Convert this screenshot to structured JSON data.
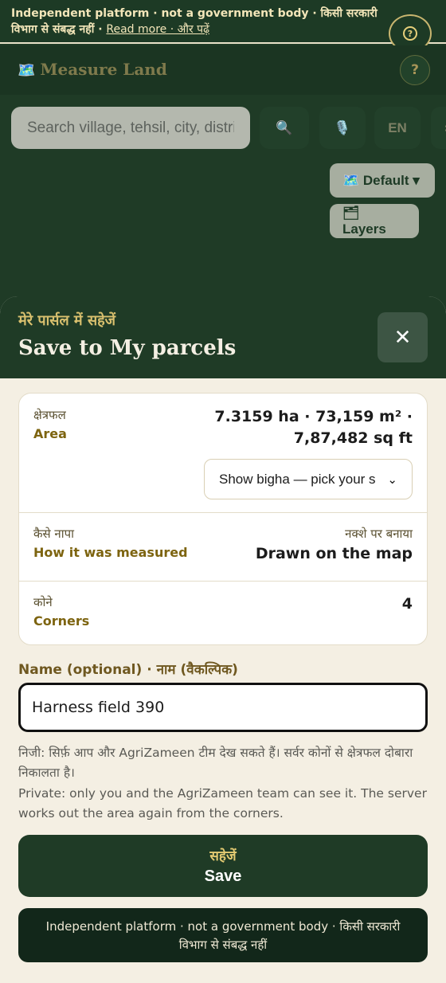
{
  "notice": {
    "text": "Independent platform · not a government body · किसी सरकारी विभाग से संबद्ध नहीं · ",
    "read_more": "Read more · और पढ़ें",
    "help_icon": "?"
  },
  "header": {
    "brand_icon": "🗺️",
    "brand": "Measure Land",
    "help_label": "?"
  },
  "search": {
    "placeholder": "Search village, tehsil, city, district"
  },
  "toolbar": {
    "search_icon": "🔍",
    "mic_icon": "🎙️",
    "lang": "EN",
    "more": "›"
  },
  "map_controls": {
    "basemap": "🗺️ Default ▾",
    "layers": "🗂 Layers"
  },
  "sheet": {
    "title_hi": "मेरे पार्सल में सहेजें",
    "title_en": "Save to My parcels",
    "close_icon": "✕"
  },
  "details": {
    "area": {
      "label_hi": "क्षेत्रफल",
      "label_en": "Area",
      "value_line1": "7.3159 ha · 73,159 m² ·",
      "value_line2": "7,87,482 sq ft",
      "bigha_select": "Show bigha — pick your s",
      "bigha_chevron": "⌄"
    },
    "method": {
      "label_hi": "कैसे नापा",
      "label_en": "How it was measured",
      "value_hi": "नक्शे पर बनाया",
      "value_en": "Drawn on the map"
    },
    "corners": {
      "label_hi": "कोने",
      "label_en": "Corners",
      "value": "4"
    }
  },
  "name_field": {
    "label": "Name (optional) · नाम (वैकल्पिक)",
    "value": "Harness field 390"
  },
  "privacy": {
    "hi": "निजी: सिर्फ़ आप और AgriZameen टीम देख सकते हैं। सर्वर कोनों से क्षेत्रफल दोबारा निकालता है।",
    "en": "Private: only you and the AgriZameen team can see it. The server works out the area again from the corners."
  },
  "save_button": {
    "hi": "सहेजें",
    "en": "Save"
  },
  "footer": {
    "text": "Independent platform · not a government body · किसी सरकारी विभाग से संबद्ध नहीं"
  },
  "colors": {
    "brand_green": "#1f3b26",
    "accent_gold": "#d9c06e",
    "sheet_bg": "#f4efe3"
  }
}
